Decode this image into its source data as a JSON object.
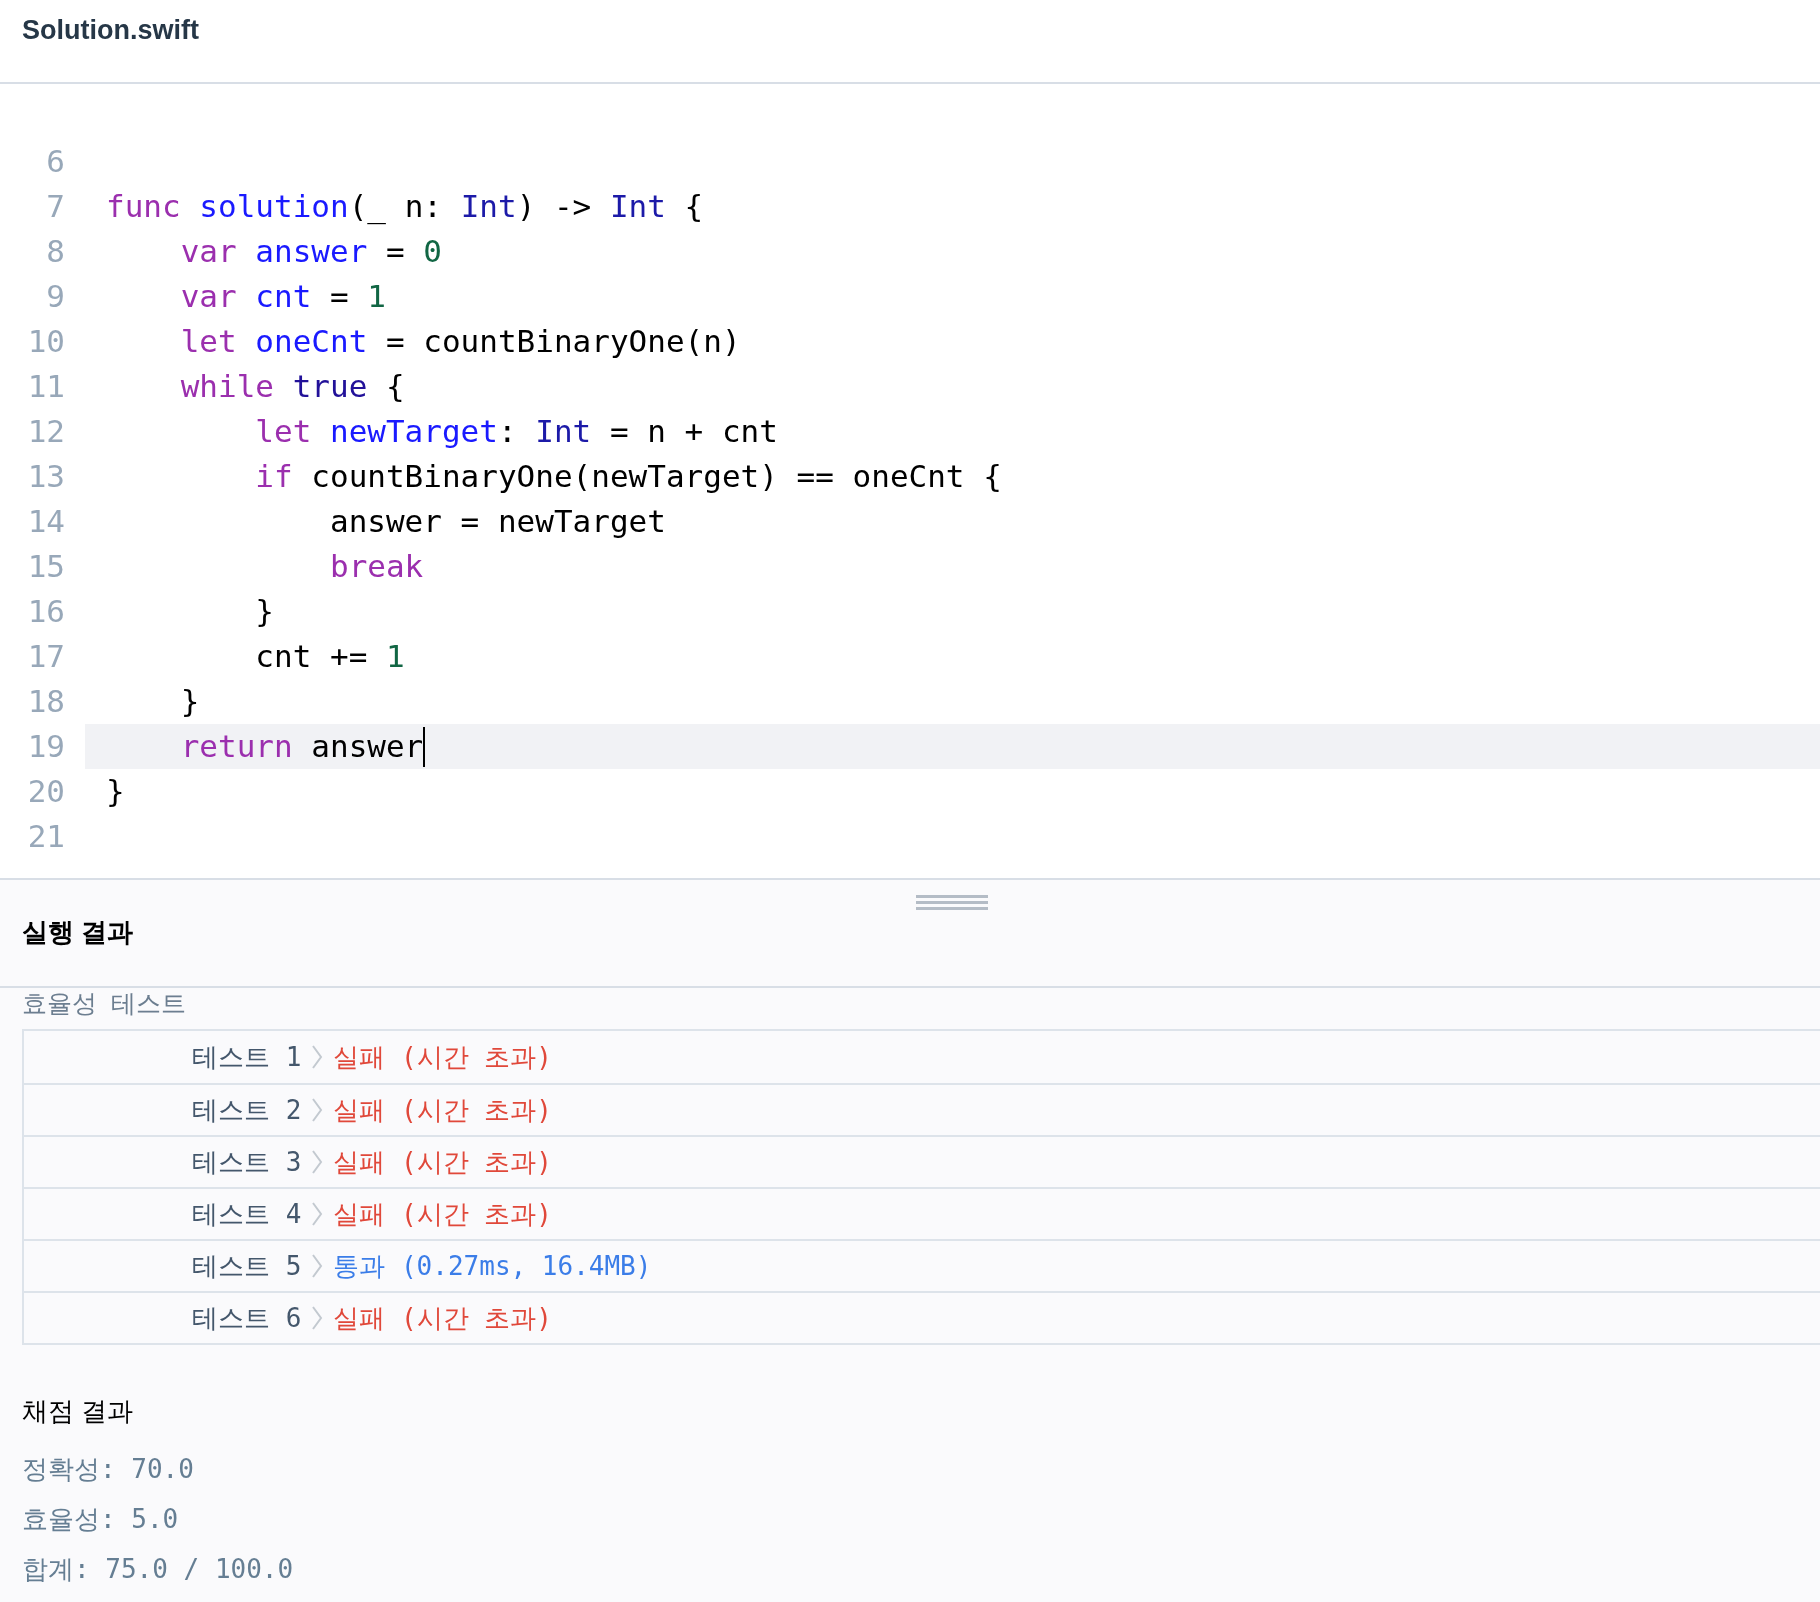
{
  "file_tab": {
    "title": "Solution.swift"
  },
  "editor": {
    "lines": [
      {
        "number": "6",
        "current": false
      },
      {
        "number": "7",
        "current": false,
        "tokens": [
          {
            "t": "func ",
            "kind": "keyword"
          },
          {
            "t": "solution",
            "kind": "name"
          },
          {
            "t": "(_ n: ",
            "kind": "plain"
          },
          {
            "t": "Int",
            "kind": "type"
          },
          {
            "t": ") -> ",
            "kind": "plain"
          },
          {
            "t": "Int",
            "kind": "type"
          },
          {
            "t": " {",
            "kind": "plain"
          }
        ]
      },
      {
        "number": "8",
        "current": false,
        "tokens": [
          {
            "t": "    var ",
            "kind": "keyword"
          },
          {
            "t": "answer",
            "kind": "name"
          },
          {
            "t": " = ",
            "kind": "plain"
          },
          {
            "t": "0",
            "kind": "number"
          }
        ]
      },
      {
        "number": "9",
        "current": false,
        "tokens": [
          {
            "t": "    var ",
            "kind": "keyword"
          },
          {
            "t": "cnt",
            "kind": "name"
          },
          {
            "t": " = ",
            "kind": "plain"
          },
          {
            "t": "1",
            "kind": "number"
          }
        ]
      },
      {
        "number": "10",
        "current": false,
        "tokens": [
          {
            "t": "    let ",
            "kind": "keyword"
          },
          {
            "t": "oneCnt",
            "kind": "name"
          },
          {
            "t": " = countBinaryOne(n)",
            "kind": "plain"
          }
        ]
      },
      {
        "number": "11",
        "current": false,
        "tokens": [
          {
            "t": "    while ",
            "kind": "keyword"
          },
          {
            "t": "true",
            "kind": "atom"
          },
          {
            "t": " {",
            "kind": "plain"
          }
        ]
      },
      {
        "number": "12",
        "current": false,
        "tokens": [
          {
            "t": "        let ",
            "kind": "keyword"
          },
          {
            "t": "newTarget",
            "kind": "name"
          },
          {
            "t": ": ",
            "kind": "plain"
          },
          {
            "t": "Int",
            "kind": "type"
          },
          {
            "t": " = n + cnt",
            "kind": "plain"
          }
        ]
      },
      {
        "number": "13",
        "current": false,
        "tokens": [
          {
            "t": "        if",
            "kind": "keyword"
          },
          {
            "t": " countBinaryOne(newTarget) == oneCnt {",
            "kind": "plain"
          }
        ]
      },
      {
        "number": "14",
        "current": false,
        "tokens": [
          {
            "t": "            answer = newTarget",
            "kind": "plain"
          }
        ]
      },
      {
        "number": "15",
        "current": false,
        "tokens": [
          {
            "t": "            break",
            "kind": "keyword"
          }
        ]
      },
      {
        "number": "16",
        "current": false,
        "tokens": [
          {
            "t": "        }",
            "kind": "plain"
          }
        ]
      },
      {
        "number": "17",
        "current": false,
        "tokens": [
          {
            "t": "        cnt += ",
            "kind": "plain"
          },
          {
            "t": "1",
            "kind": "number"
          }
        ]
      },
      {
        "number": "18",
        "current": false,
        "tokens": [
          {
            "t": "    }",
            "kind": "plain"
          }
        ]
      },
      {
        "number": "19",
        "current": true,
        "tokens": [
          {
            "t": "    return",
            "kind": "keyword"
          },
          {
            "t": " answer",
            "kind": "plain"
          }
        ]
      },
      {
        "number": "20",
        "current": false,
        "tokens": [
          {
            "t": "}",
            "kind": "plain"
          }
        ]
      },
      {
        "number": "21",
        "current": false
      }
    ]
  },
  "results": {
    "title": "실행 결과",
    "section_label": "효율성  테스트",
    "tests": [
      {
        "label": "테스트 1",
        "result": "실패 (시간 초과)",
        "kind": "fail"
      },
      {
        "label": "테스트 2",
        "result": "실패 (시간 초과)",
        "kind": "fail"
      },
      {
        "label": "테스트 3",
        "result": "실패 (시간 초과)",
        "kind": "fail"
      },
      {
        "label": "테스트 4",
        "result": "실패 (시간 초과)",
        "kind": "fail"
      },
      {
        "label": "테스트 5",
        "result": "통과 (0.27ms, 16.4MB)",
        "kind": "pass"
      },
      {
        "label": "테스트 6",
        "result": "실패 (시간 초과)",
        "kind": "fail"
      }
    ],
    "grading_title": "채점 결과",
    "scores": [
      "정확성: 70.0",
      "효율성: 5.0",
      "합계: 75.0 / 100.0"
    ]
  }
}
